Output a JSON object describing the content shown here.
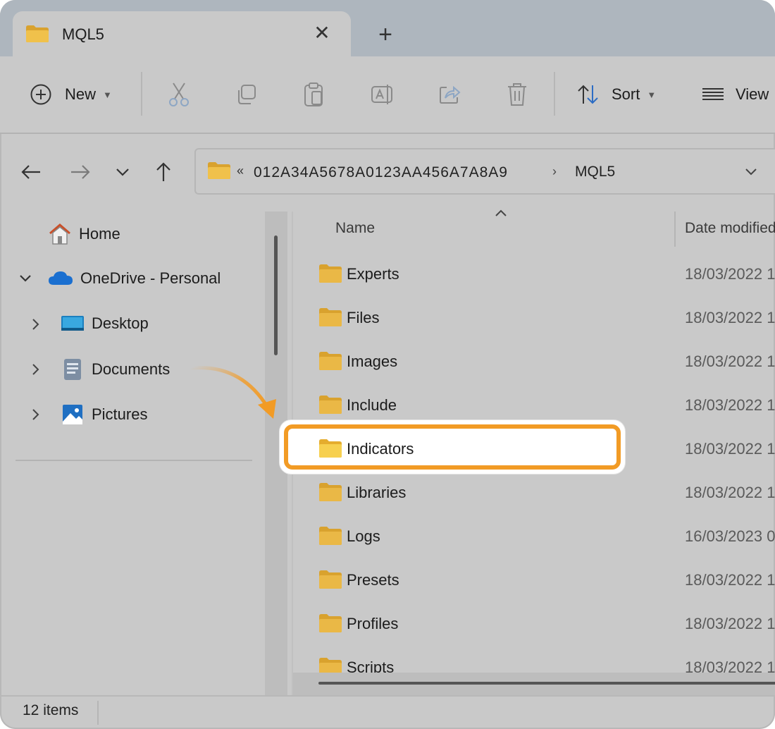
{
  "window": {
    "tab_title": "MQL5",
    "close_glyph": "✕",
    "new_tab_glyph": "+"
  },
  "toolbar": {
    "new_label": "New",
    "sort_label": "Sort",
    "view_label": "View"
  },
  "address": {
    "overflow_glyph": "«",
    "segments": [
      "012A34A5678A0123AA456A7A8A9",
      "MQL5"
    ],
    "separator": "›"
  },
  "sidebar": {
    "items": [
      {
        "label": "Home",
        "icon": "home-icon"
      },
      {
        "label": "OneDrive - Personal",
        "icon": "cloud-icon"
      },
      {
        "label": "Desktop",
        "icon": "desktop-icon"
      },
      {
        "label": "Documents",
        "icon": "documents-icon"
      },
      {
        "label": "Pictures",
        "icon": "pictures-icon"
      }
    ]
  },
  "columns": {
    "name": "Name",
    "date": "Date modified"
  },
  "files": [
    {
      "name": "Experts",
      "date": "18/03/2022 1"
    },
    {
      "name": "Files",
      "date": "18/03/2022 1"
    },
    {
      "name": "Images",
      "date": "18/03/2022 1"
    },
    {
      "name": "Include",
      "date": "18/03/2022 1"
    },
    {
      "name": "Indicators",
      "date": "18/03/2022 1"
    },
    {
      "name": "Libraries",
      "date": "18/03/2022 1"
    },
    {
      "name": "Logs",
      "date": "16/03/2023 0"
    },
    {
      "name": "Presets",
      "date": "18/03/2022 1"
    },
    {
      "name": "Profiles",
      "date": "18/03/2022 1"
    },
    {
      "name": "Scripts",
      "date": "18/03/2022 1"
    }
  ],
  "status": {
    "item_count": "12 items"
  },
  "colors": {
    "highlight": "#f29b25",
    "folder": "#e3b23c"
  }
}
